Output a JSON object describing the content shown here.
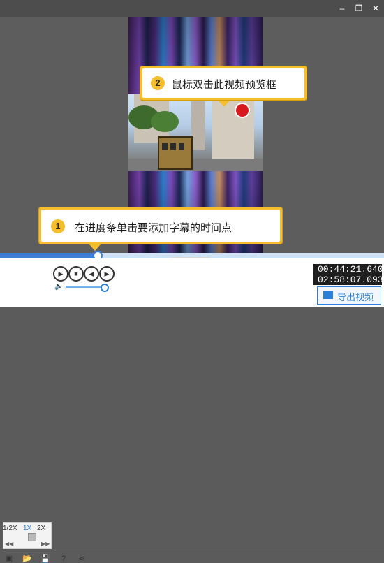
{
  "window": {
    "minimize_glyph": "‒",
    "restore_glyph": "❐",
    "close_glyph": "✕"
  },
  "callouts": {
    "preview": {
      "number": "2",
      "text": "鼠标双击此视频预览框"
    },
    "timeline": {
      "number": "1",
      "text": "在进度条单击要添加字幕的时间点"
    }
  },
  "timeline": {
    "progress_fraction": 0.25
  },
  "speed": {
    "options": [
      "1/2X",
      "1X",
      "2X"
    ],
    "selected": "1X"
  },
  "volume": {
    "level_fraction": 0.95
  },
  "time": {
    "current": "00:44:21.640",
    "total": "02:58:07.093"
  },
  "export": {
    "label": "导出视频"
  },
  "icons": [
    "minimize-icon",
    "restore-icon",
    "close-icon",
    "play-icon",
    "stop-icon",
    "previous-icon",
    "next-icon",
    "volume-icon",
    "open-folder-icon",
    "save-icon",
    "help-icon",
    "share-icon",
    "export-icon",
    "collapse-chevron-icon"
  ],
  "colors": {
    "accent": "#2b7fd6",
    "callout": "#f5be2d",
    "dark": "#1e1e1e"
  }
}
